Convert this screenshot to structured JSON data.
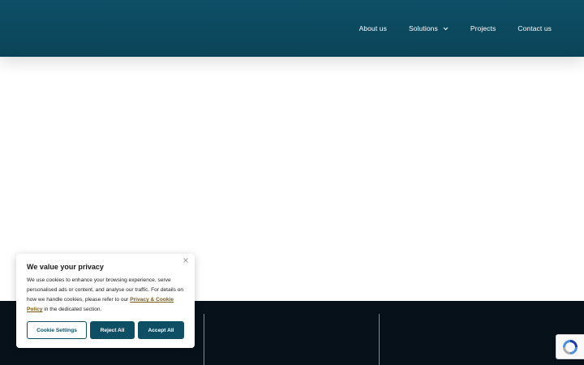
{
  "header": {
    "nav": [
      {
        "label": "About us",
        "dropdown": false
      },
      {
        "label": "Solutions",
        "dropdown": true
      },
      {
        "label": "Projects",
        "dropdown": false
      },
      {
        "label": "Contact us",
        "dropdown": false
      }
    ]
  },
  "cookie_banner": {
    "title": "We value your privacy",
    "body_text": "We use cookies to enhance your browsing experience, serve personalised ads or content, and analyse our traffic. For details on how we handle cookies, please refer to our",
    "link_text": "Privacy & Cookie Policy",
    "body_suffix": "in the dedicated section.",
    "buttons": {
      "settings": "Cookie Settings",
      "reject": "Reject All",
      "accept": "Accept All"
    },
    "close_icon": "close-icon"
  },
  "recaptcha_badge": {
    "icon": "recaptcha-icon"
  },
  "colors": {
    "header_bg": "#0e4f66",
    "footer_bg": "#061119",
    "button_bg": "#0e4f66",
    "link": "#7a5a12"
  }
}
